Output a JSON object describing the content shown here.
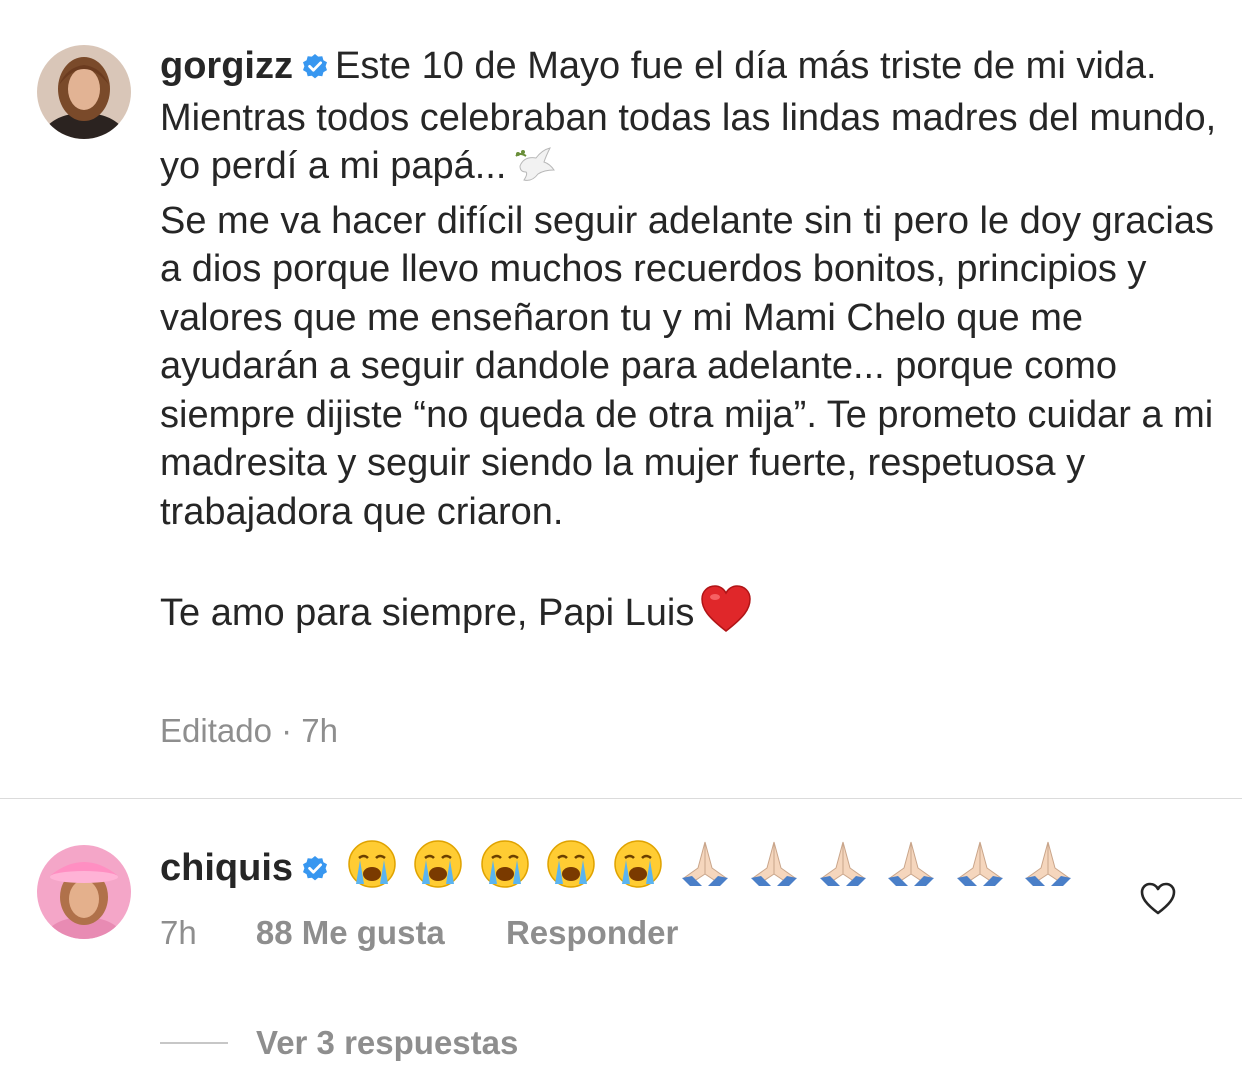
{
  "post": {
    "username": "gorgizz",
    "verified": true,
    "caption_first": "Este 10 de Mayo fue el día más triste de mi vida. Mientras todos celebraban todas las lindas madres del mundo, yo perdí a mi papá...",
    "caption_emoji_1": "dove-emoji",
    "caption_body": "Se me va hacer difícil seguir adelante sin ti pero le doy gracias a dios porque llevo muchos recuerdos bonitos, principios y valores que me enseñaron tu y mi Mami Chelo que me ayudarán a seguir dandole para adelante... porque como siempre dijiste “no queda de otra mija”. Te prometo cuidar a mi madresita y seguir siendo la mujer fuerte, respetuosa y trabajadora que criaron.",
    "caption_closing": "Te amo para siempre, Papi Luis",
    "caption_emoji_2": "red-heart-emoji",
    "edited_label": "Editado · 7h"
  },
  "comment": {
    "username": "chiquis",
    "verified": true,
    "emojis": [
      "😭",
      "😭",
      "😭",
      "😭",
      "😭",
      "🙏",
      "🙏",
      "🙏",
      "🙏",
      "🙏",
      "🙏"
    ],
    "time": "7h",
    "likes": "88 Me gusta",
    "reply_label": "Responder",
    "like_icon": "heart-outline-icon"
  },
  "view_replies": "Ver 3 respuestas",
  "colors": {
    "text": "#262626",
    "secondary": "#8e8e8e",
    "verified": "#3897f0",
    "divider": "#dbdbdb"
  }
}
